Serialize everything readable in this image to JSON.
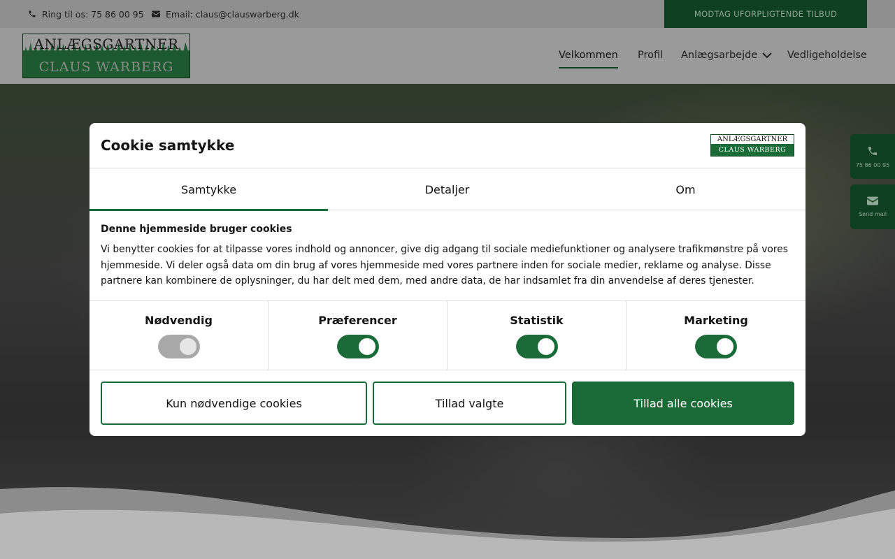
{
  "topbar": {
    "phone_label": "Ring til os: 75 86 00 95",
    "email_label": "Email: claus@clauswarberg.dk",
    "cta_label": "MODTAG UFORPLIGTENDE TILBUD"
  },
  "header": {
    "logo_line1": "ANLÆGSGARTNER",
    "logo_line2": "CLAUS WARBERG",
    "nav": [
      {
        "label": "Velkommen",
        "active": true
      },
      {
        "label": "Profil"
      },
      {
        "label": "Anlægsarbejde",
        "has_dropdown": true
      },
      {
        "label": "Vedligeholdelse"
      }
    ]
  },
  "side_buttons": {
    "phone_label": "75 86 00 95",
    "mail_label": "Send mail"
  },
  "cookie_dialog": {
    "title": "Cookie samtykke",
    "logo_line1": "ANLÆGSGARTNER",
    "logo_line2": "CLAUS WARBERG",
    "tabs": [
      {
        "label": "Samtykke",
        "active": true
      },
      {
        "label": "Detaljer"
      },
      {
        "label": "Om"
      }
    ],
    "body_title": "Denne hjemmeside bruger cookies",
    "body_text": "Vi benytter cookies for at tilpasse vores indhold og annoncer, give dig adgang til sociale mediefunktioner og analysere trafikmønstre på vores hjemmeside. Vi deler også data om din brug af vores hjemmeside med vores partnere inden for sociale medier, reklame og analyse. Disse partnere kan kombinere de oplysninger, du har delt med dem, med andre data, de har indsamlet fra din anvendelse af deres tjenester.",
    "categories": [
      {
        "label": "Nødvendig",
        "enabled": true,
        "locked": true
      },
      {
        "label": "Præferencer",
        "enabled": true
      },
      {
        "label": "Statistik",
        "enabled": true
      },
      {
        "label": "Marketing",
        "enabled": true
      }
    ],
    "buttons": {
      "necessary_only": "Kun nødvendige cookies",
      "allow_selected": "Tillad valgte",
      "allow_all": "Tillad alle cookies"
    }
  },
  "colors": {
    "brand_green": "#1a6b37",
    "dark_green": "#0e3f21"
  }
}
